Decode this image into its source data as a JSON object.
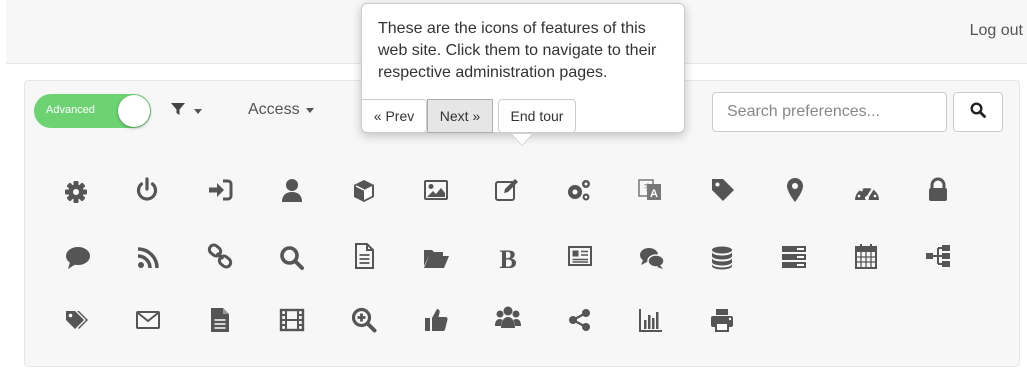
{
  "header": {
    "logout_label": "Log out"
  },
  "toolbar": {
    "mode_toggle_label": "Advanced",
    "access_label": "Access",
    "search_placeholder": "Search preferences..."
  },
  "tour": {
    "text": "These are the icons of features of this web site. Click them to navigate to their respective administration pages.",
    "prev_label": "« Prev",
    "next_label": "Next »",
    "end_label": "End tour"
  },
  "colors": {
    "icon": "#555555",
    "toggle_on": "#6dd372",
    "panel_bg": "#f7f7f7"
  },
  "feature_icons": [
    [
      "gear-icon",
      "power-icon",
      "sign-in-icon",
      "user-icon",
      "cube-icon",
      "image-icon",
      "edit-icon",
      "cogs-icon",
      "translate-icon",
      "tag-icon",
      "map-marker-icon",
      "dashboard-icon",
      "lock-icon"
    ],
    [
      "comment-icon",
      "rss-icon",
      "link-icon",
      "search-icon",
      "file-text-icon",
      "folder-open-icon",
      "bold-icon",
      "newspaper-icon",
      "comments-icon",
      "database-icon",
      "server-icon",
      "calendar-icon",
      "sitemap-icon"
    ],
    [
      "tags-icon",
      "envelope-icon",
      "file-icon",
      "film-icon",
      "zoom-in-icon",
      "thumbs-up-icon",
      "users-icon",
      "share-icon",
      "bar-chart-icon",
      "print-icon"
    ]
  ]
}
